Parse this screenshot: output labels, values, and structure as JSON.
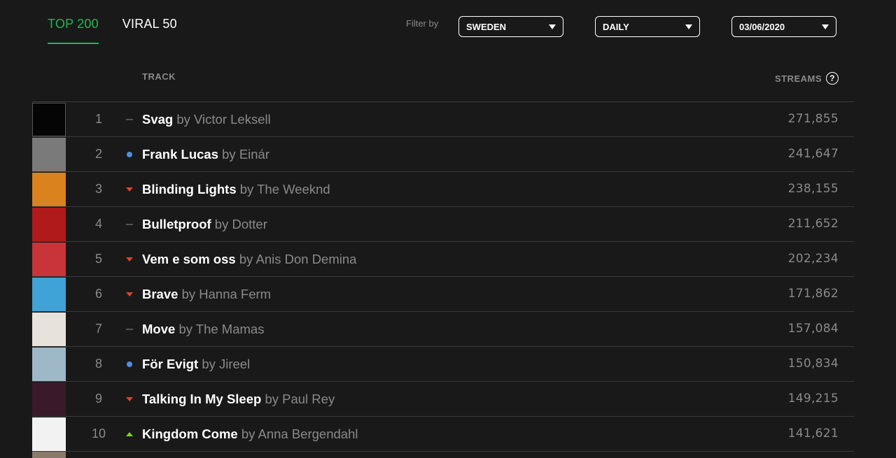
{
  "tabs": [
    {
      "label": "TOP 200",
      "active": true
    },
    {
      "label": "VIRAL 50",
      "active": false
    }
  ],
  "filter": {
    "label": "Filter by",
    "country": "SWEDEN",
    "frequency": "DAILY",
    "date": "03/06/2020"
  },
  "columns": {
    "track": "TRACK",
    "streams": "STREAMS",
    "help_icon": "?"
  },
  "trend_colors": {
    "new": "#4f8fe0",
    "down": "#e0442c",
    "up": "#7ed321",
    "same": "#555555"
  },
  "rows": [
    {
      "rank": "1",
      "trend": "same",
      "title": "Svag",
      "by": "by Victor Leksell",
      "streams": "271,855",
      "art": "#050505"
    },
    {
      "rank": "2",
      "trend": "new",
      "title": "Frank Lucas",
      "by": "by Einár",
      "streams": "241,647",
      "art": "#7a7a7a"
    },
    {
      "rank": "3",
      "trend": "down",
      "title": "Blinding Lights",
      "by": "by The Weeknd",
      "streams": "238,155",
      "art": "#d9821e"
    },
    {
      "rank": "4",
      "trend": "same",
      "title": "Bulletproof",
      "by": "by Dotter",
      "streams": "211,652",
      "art": "#b11a1a"
    },
    {
      "rank": "5",
      "trend": "down",
      "title": "Vem e som oss",
      "by": "by Anis Don Demina",
      "streams": "202,234",
      "art": "#c9333a"
    },
    {
      "rank": "6",
      "trend": "down",
      "title": "Brave",
      "by": "by Hanna Ferm",
      "streams": "171,862",
      "art": "#3fa3d8"
    },
    {
      "rank": "7",
      "trend": "same",
      "title": "Move",
      "by": "by The Mamas",
      "streams": "157,084",
      "art": "#e8e2dc"
    },
    {
      "rank": "8",
      "trend": "new",
      "title": "För Evigt",
      "by": "by Jireel",
      "streams": "150,834",
      "art": "#9fb8c8"
    },
    {
      "rank": "9",
      "trend": "down",
      "title": "Talking In My Sleep",
      "by": "by Paul Rey",
      "streams": "149,215",
      "art": "#3a1a2a"
    },
    {
      "rank": "10",
      "trend": "up",
      "title": "Kingdom Come",
      "by": "by Anna Bergendahl",
      "streams": "141,621",
      "art": "#f2f2f2"
    }
  ]
}
